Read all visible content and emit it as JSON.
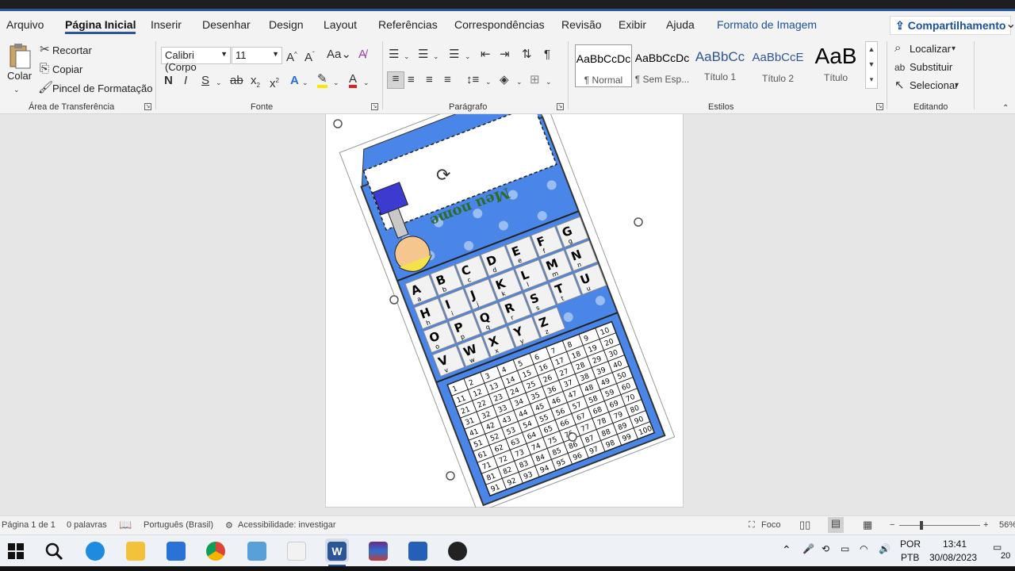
{
  "tabs": [
    "Arquivo",
    "Página Inicial",
    "Inserir",
    "Desenhar",
    "Design",
    "Layout",
    "Referências",
    "Correspondências",
    "Revisão",
    "Exibir",
    "Ajuda",
    "Formato de Imagem"
  ],
  "share_label": "Compartilhamento",
  "clipboard": {
    "paste": "Colar",
    "cut": "Recortar",
    "copy": "Copiar",
    "format_painter": "Pincel de Formatação",
    "group": "Área de Transferência"
  },
  "font": {
    "name": "Calibri (Corpo",
    "size": "11",
    "group": "Fonte"
  },
  "paragraph": {
    "group": "Parágrafo"
  },
  "styles": {
    "group": "Estilos",
    "items": [
      {
        "preview": "AaBbCcDc",
        "name": "¶ Normal"
      },
      {
        "preview": "AaBbCcDc",
        "name": "¶ Sem Esp..."
      },
      {
        "preview": "AaBbCc",
        "name": "Título 1"
      },
      {
        "preview": "AaBbCcE",
        "name": "Título 2"
      },
      {
        "preview": "AaB",
        "name": "Título"
      }
    ]
  },
  "editing": {
    "group": "Editando",
    "find": "Localizar",
    "replace": "Substituir",
    "select": "Selecionar"
  },
  "document": {
    "title_label": "Meu nome",
    "letters": [
      "A",
      "B",
      "C",
      "D",
      "E",
      "F",
      "G",
      "H",
      "I",
      "J",
      "K",
      "L",
      "M",
      "N",
      "O",
      "P",
      "Q",
      "R",
      "S",
      "T",
      "U",
      "V",
      "W",
      "X",
      "Y",
      "Z"
    ],
    "grid_size": 10
  },
  "status": {
    "page": "Página 1 de 1",
    "words": "0 palavras",
    "language": "Português (Brasil)",
    "accessibility": "Acessibilidade: investigar",
    "focus": "Foco",
    "zoom": "56%"
  },
  "tray": {
    "lang1": "POR",
    "lang2": "PTB",
    "time": "13:41",
    "date": "30/08/2023",
    "notif": "20"
  },
  "colors": {
    "accent": "#2b579a",
    "card_blue": "#4a86e8",
    "grid_blue": "#3f73d8"
  }
}
